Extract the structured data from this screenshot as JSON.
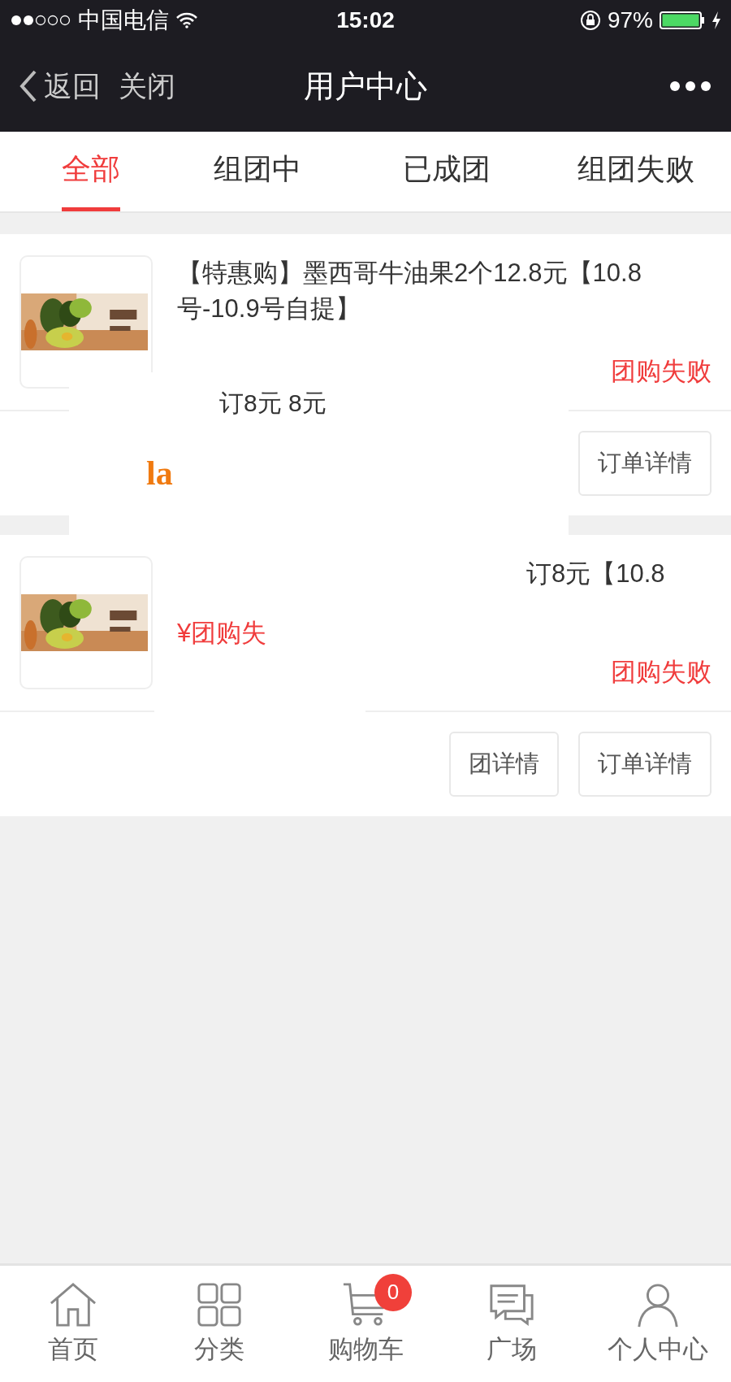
{
  "status_bar": {
    "carrier": "中国电信",
    "time": "15:02",
    "battery": "97%"
  },
  "nav": {
    "back": "返回",
    "close": "关闭",
    "title": "用户中心"
  },
  "tabs": [
    {
      "label": "全部",
      "selected": true
    },
    {
      "label": "组团中",
      "selected": false
    },
    {
      "label": "已成团",
      "selected": false
    },
    {
      "label": "组团失败",
      "selected": false
    }
  ],
  "orders": [
    {
      "title": "【特惠购】墨西哥牛油果2个12.8元【10.8号-10.9号自提】",
      "status": "团购失败",
      "buttons": [
        "订单详情"
      ],
      "fragments": [
        {
          "kind": "text",
          "text": "订8元 8元"
        },
        {
          "kind": "accent",
          "text": "la"
        }
      ]
    },
    {
      "title": "订8元【10.8",
      "status": "团购失败",
      "buttons": [
        "团详情",
        "订单详情"
      ],
      "fragments": [
        {
          "kind": "price",
          "text": "¥团购失"
        }
      ]
    }
  ],
  "tab_bar": [
    {
      "label": "首页",
      "kind": "home"
    },
    {
      "label": "分类",
      "kind": "grid"
    },
    {
      "label": "购物车",
      "kind": "cart",
      "badge": "0"
    },
    {
      "label": "广场",
      "kind": "chat"
    },
    {
      "label": "个人中心",
      "kind": "user"
    }
  ]
}
